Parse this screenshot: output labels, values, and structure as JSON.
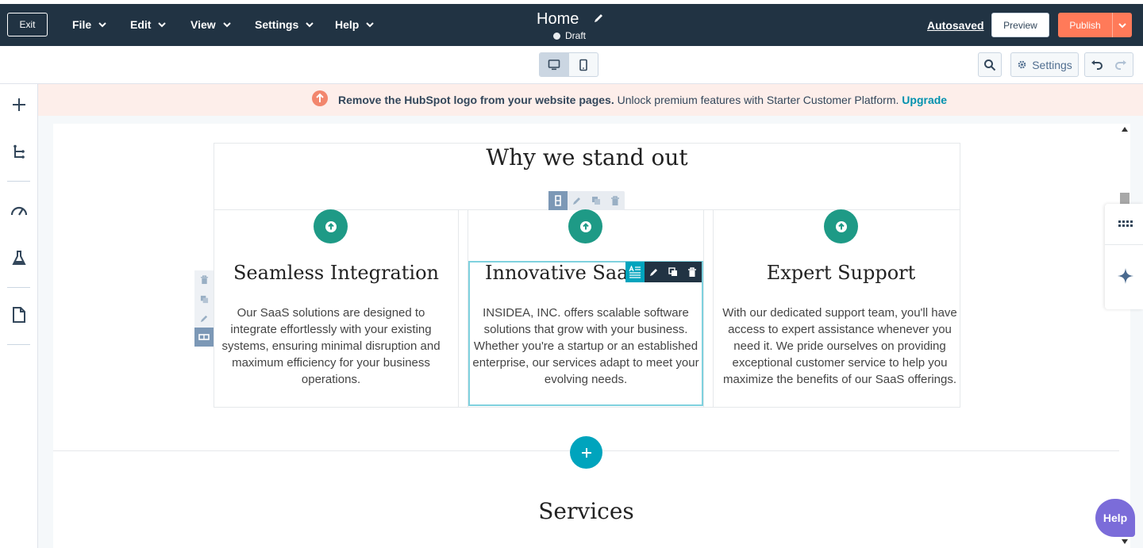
{
  "topbar": {
    "exit_label": "Exit",
    "menus": [
      "File",
      "Edit",
      "View",
      "Settings",
      "Help"
    ],
    "page_title": "Home",
    "status": "Draft",
    "autosaved": "Autosaved",
    "preview_label": "Preview",
    "publish_label": "Publish",
    "colors": {
      "bar": "#213343",
      "publish": "#ff7a59"
    }
  },
  "toolbar": {
    "settings_label": "Settings",
    "icons": [
      "desktop-icon",
      "mobile-icon",
      "search-icon",
      "gear-icon",
      "undo-icon",
      "redo-icon"
    ]
  },
  "leftrail": {
    "icons": [
      "add-icon",
      "layers-icon",
      "speedometer-icon",
      "flask-icon",
      "document-icon"
    ]
  },
  "banner": {
    "bold_text": "Remove the HubSpot logo from your website pages.",
    "text": " Unlock premium features with Starter Customer Platform. ",
    "link": "Upgrade"
  },
  "content": {
    "section_heading": "Why we stand out",
    "columns": [
      {
        "title": "Seamless Integration",
        "text": "Our SaaS solutions are designed to integrate effortlessly with your existing systems, ensuring minimal disruption and maximum efficiency for your business operations."
      },
      {
        "title": "Innovative SaaS S",
        "text": "INSIDEA, INC. offers scalable software solutions that grow with your business. Whether you're a startup or an established enterprise, our services adapt to meet your evolving needs."
      },
      {
        "title": "Expert Support",
        "text": "With our dedicated support team, you'll have access to expert assistance whenever you need it. We pride ourselves on providing exceptional customer service to help you maximize the benefits of our SaaS offerings."
      }
    ],
    "next_heading": "Services",
    "accent": "#1e9a86"
  },
  "help_label": "Help"
}
